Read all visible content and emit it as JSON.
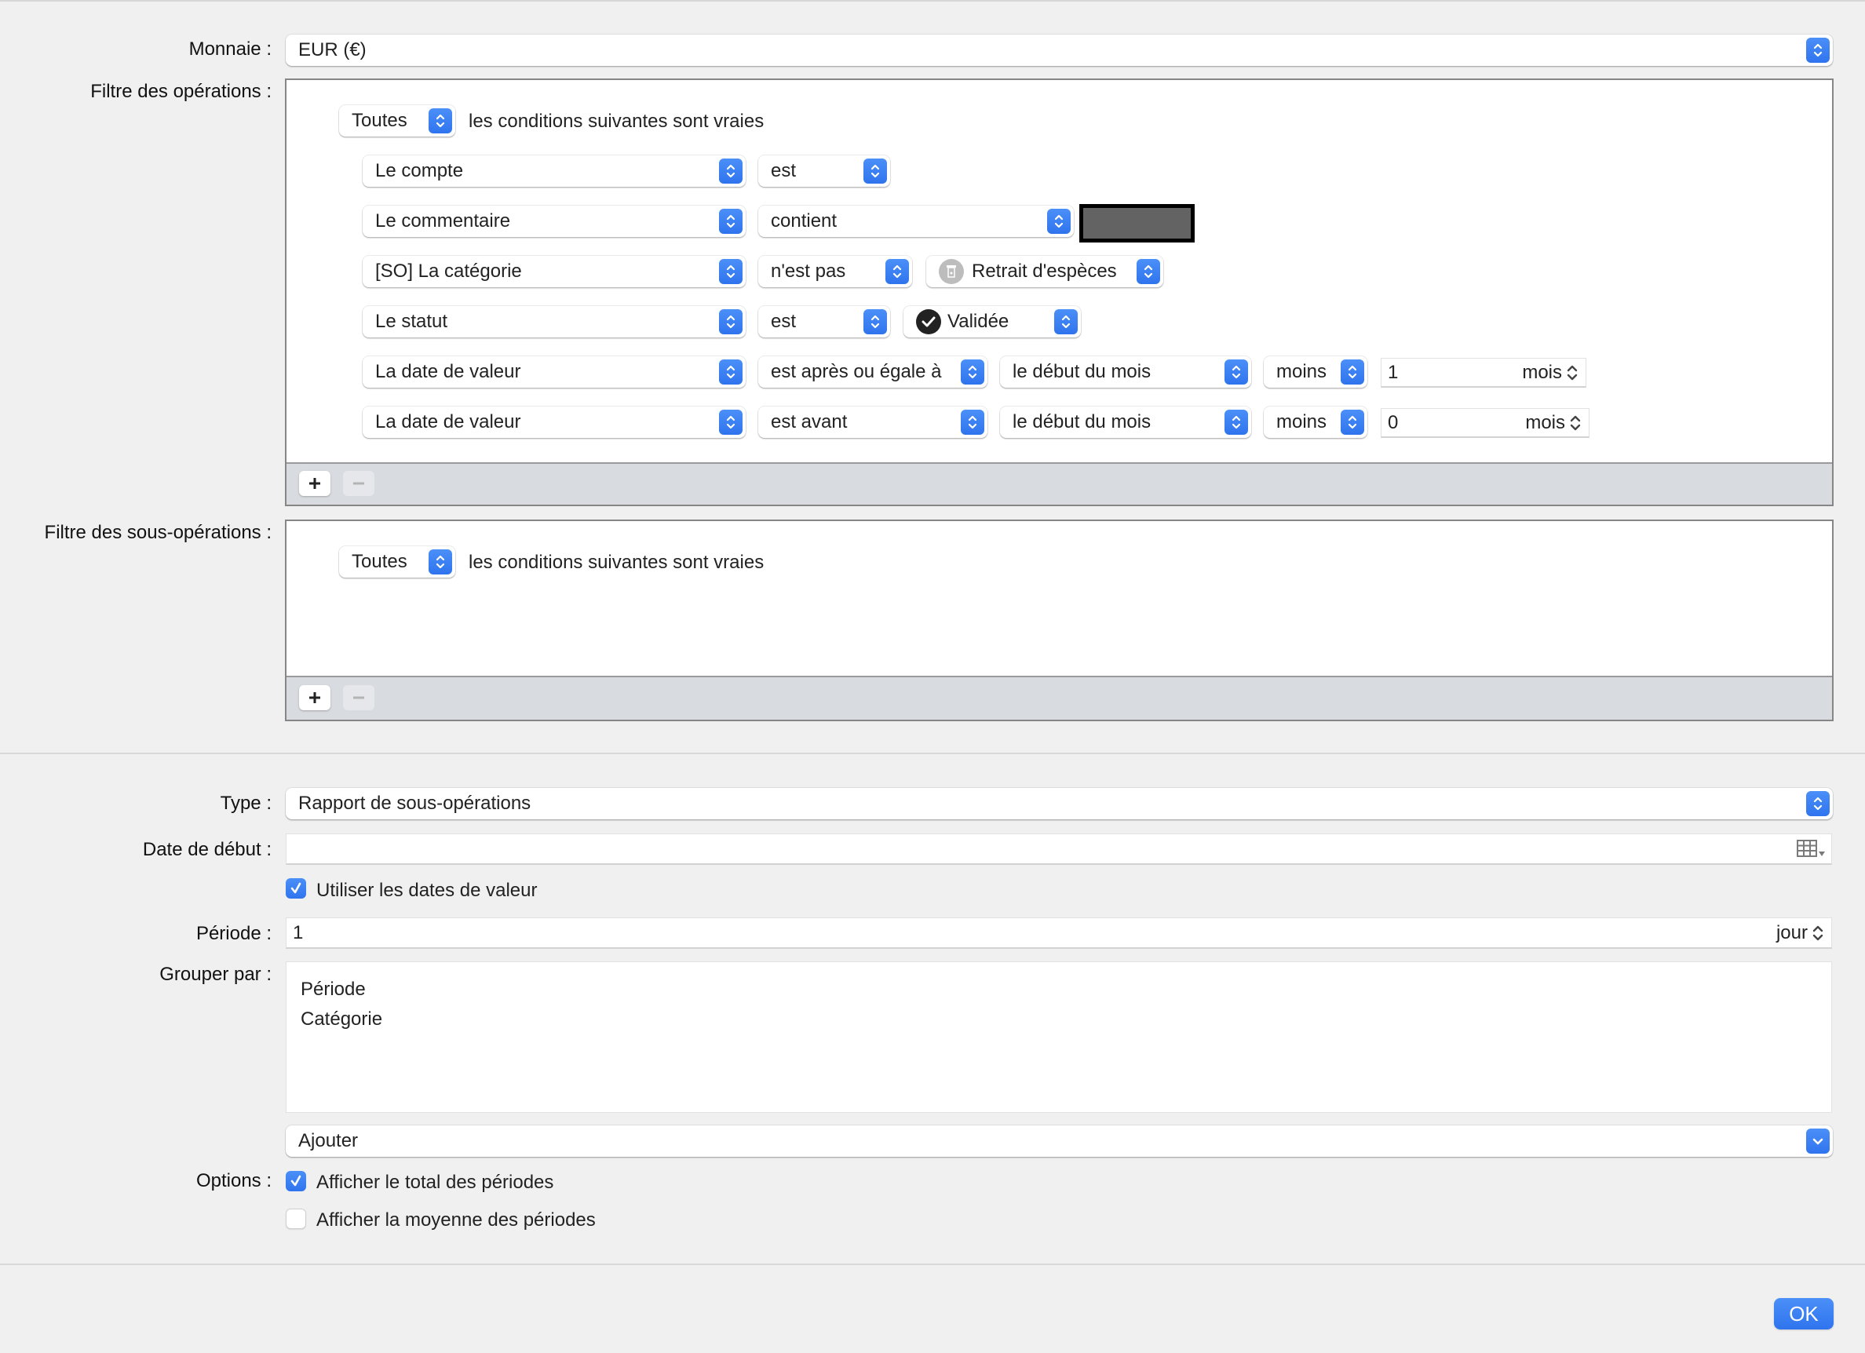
{
  "currency": {
    "label": "Monnaie :",
    "value": "EUR (€)"
  },
  "operations_filter": {
    "label": "Filtre des opérations :",
    "match_mode": "Toutes",
    "match_text": "les conditions suivantes sont vraies",
    "conditions": [
      {
        "field": "Le compte",
        "operator": "est"
      },
      {
        "field": "Le commentaire",
        "operator": "contient",
        "value": "[masqué]"
      },
      {
        "field": "[SO] La catégorie",
        "operator": "n'est pas",
        "value": "Retrait d'espèces",
        "value_icon": "atm-withdrawal-icon"
      },
      {
        "field": "Le statut",
        "operator": "est",
        "value": "Validée",
        "value_icon": "checkmark-circle-icon"
      },
      {
        "field": "La date de valeur",
        "operator": "est après ou égale à",
        "reference": "le début du mois",
        "offset_op": "moins",
        "offset_value": "1",
        "offset_unit": "mois"
      },
      {
        "field": "La date de valeur",
        "operator": "est avant",
        "reference": "le début du mois",
        "offset_op": "moins",
        "offset_value": "0",
        "offset_unit": "mois"
      }
    ],
    "add_label": "+",
    "remove_label": "−"
  },
  "suboperations_filter": {
    "label": "Filtre des sous-opérations :",
    "match_mode": "Toutes",
    "match_text": "les conditions suivantes sont vraies",
    "add_label": "+",
    "remove_label": "−"
  },
  "report": {
    "type_label": "Type :",
    "type_value": "Rapport de sous-opérations",
    "start_date_label": "Date de début :",
    "start_date_value": "",
    "use_value_dates_label": "Utiliser les dates de valeur",
    "use_value_dates_checked": true,
    "period_label": "Période :",
    "period_value": "1",
    "period_unit": "jour",
    "group_by_label": "Grouper par :",
    "group_by_items": [
      "Période",
      "Catégorie"
    ],
    "add_group_label": "Ajouter",
    "options_label": "Options :",
    "options": [
      {
        "label": "Afficher le total des périodes",
        "checked": true
      },
      {
        "label": "Afficher la moyenne des périodes",
        "checked": false
      }
    ]
  },
  "footer": {
    "ok_label": "OK"
  },
  "colors": {
    "accent": "#3b82f6",
    "background": "#f0f0f0",
    "filter_footer": "#d8dbdf"
  }
}
